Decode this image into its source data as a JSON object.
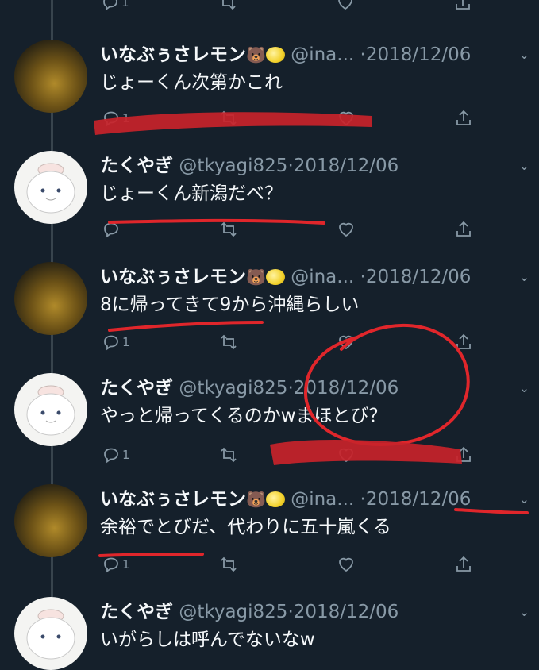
{
  "tweets": [
    {
      "kind": "ina",
      "display_name": "いなぶぅさレモン",
      "handle": "@ina...",
      "date": "2018/12/06",
      "text": "じょーくん次第かこれ",
      "reply_count": "1"
    },
    {
      "kind": "tky",
      "display_name": "たくやぎ",
      "handle": "@tkyagi825",
      "date": "2018/12/06",
      "text": "じょーくん新潟だべ？",
      "reply_count": ""
    },
    {
      "kind": "ina",
      "display_name": "いなぶぅさレモン",
      "handle": "@ina...",
      "date": "2018/12/06",
      "text": "8に帰ってきて9から沖縄らしい",
      "reply_count": "1"
    },
    {
      "kind": "tky",
      "display_name": "たくやぎ",
      "handle": "@tkyagi825",
      "date": "2018/12/06",
      "text": "やっと帰ってくるのかwまほとび？",
      "reply_count": "1"
    },
    {
      "kind": "ina",
      "display_name": "いなぶぅさレモン",
      "handle": "@ina...",
      "date": "2018/12/06",
      "text": "余裕でとびだ、代わりに五十嵐くる",
      "reply_count": "1"
    },
    {
      "kind": "tky",
      "display_name": "たくやぎ",
      "handle": "@tkyagi825",
      "date": "2018/12/06",
      "text": "いがらしは呼んでないなw",
      "reply_count": ""
    }
  ],
  "top_actions": {
    "reply_count": "1"
  },
  "icons": {
    "reply": "reply-icon",
    "retweet": "retweet-icon",
    "like": "heart-icon",
    "share": "share-icon",
    "more": "chevron-down-icon"
  },
  "colors": {
    "background": "#15202b",
    "annotation_red": "#e0262b"
  }
}
